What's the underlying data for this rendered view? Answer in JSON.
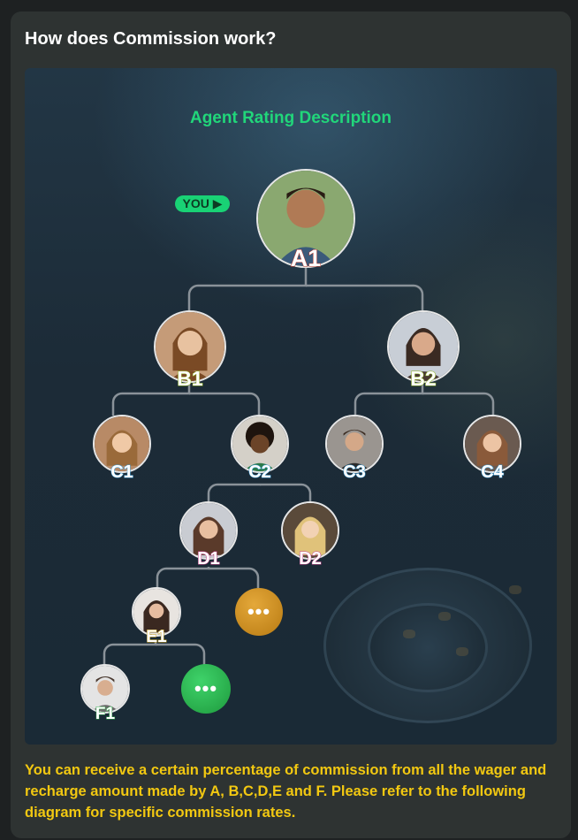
{
  "card": {
    "title": "How does Commission work?"
  },
  "diagram": {
    "title": "Agent Rating Description",
    "you_badge": "YOU",
    "more_symbol": "•••",
    "nodes": {
      "a1": "A1",
      "b1": "B1",
      "b2": "B2",
      "c1": "C1",
      "c2": "C2",
      "c3": "C3",
      "c4": "C4",
      "d1": "D1",
      "d2": "D2",
      "e1": "E1",
      "f1": "F1"
    },
    "colors": {
      "title": "#21d67a",
      "badge": "#19d275",
      "a": "#c0392b",
      "b": "#8ab21a",
      "c": "#3f9fd8",
      "d": "#c5418a",
      "e": "#c9a21c",
      "f": "#2fa64a",
      "more_gold": "#d39422",
      "more_green": "#2eb653"
    }
  },
  "footer": {
    "text": "You can receive a certain percentage of commission from all the wager and recharge amount made by A, B,C,D,E and F. Please refer to the following diagram for specific commission rates."
  }
}
